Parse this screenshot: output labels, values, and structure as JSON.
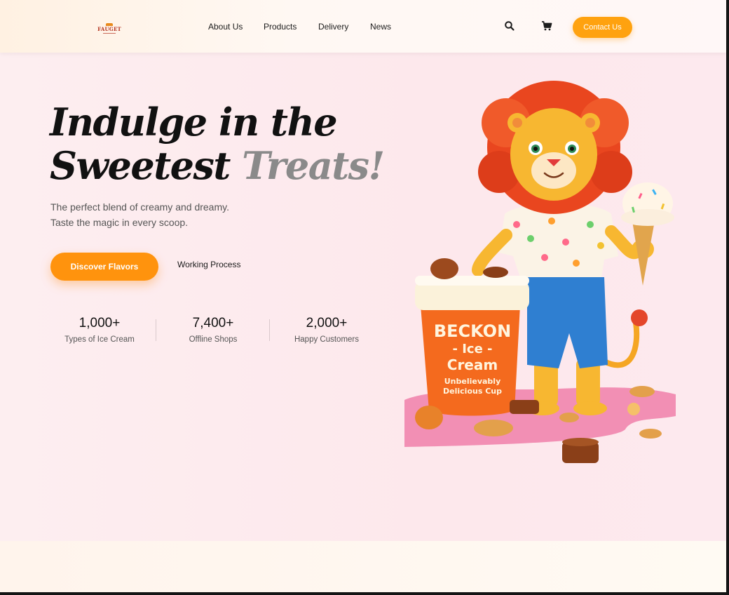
{
  "header": {
    "logo": {
      "text": "FAUGET",
      "icon": "crown-logo-icon"
    },
    "nav": [
      {
        "label": "About Us"
      },
      {
        "label": "Products"
      },
      {
        "label": "Delivery"
      },
      {
        "label": "News"
      }
    ],
    "icons": {
      "search": "search-icon",
      "cart": "cart-icon"
    },
    "contact_label": "Contact Us"
  },
  "hero": {
    "headline_line1": "Indulge in the",
    "headline_line2_a": "Sweetest ",
    "headline_line2_b": "Treats!",
    "subtext_line1": "The perfect blend of creamy and dreamy.",
    "subtext_line2": "Taste the magic in every scoop.",
    "primary_cta": "Discover Flavors",
    "secondary_cta": "Working Process",
    "stats": [
      {
        "value": "1,000+",
        "label": "Types of Ice Cream"
      },
      {
        "value": "7,400+",
        "label": "Offline Shops"
      },
      {
        "value": "2,000+",
        "label": "Happy Customers"
      }
    ],
    "illustration": {
      "icon": "lion-mascot-illustration",
      "tub_brand": "BECKON",
      "tub_line2": "- Ice -",
      "tub_line3": "Cream",
      "tub_tag1": "Unbelievably",
      "tub_tag2": "Delicious Cup"
    }
  },
  "colors": {
    "accent": "#ffa20f",
    "accent_dark": "#ff930d",
    "hero_bg": "#fdeef0",
    "headline": "#111111",
    "headline_accent": "#8a8a8a"
  }
}
